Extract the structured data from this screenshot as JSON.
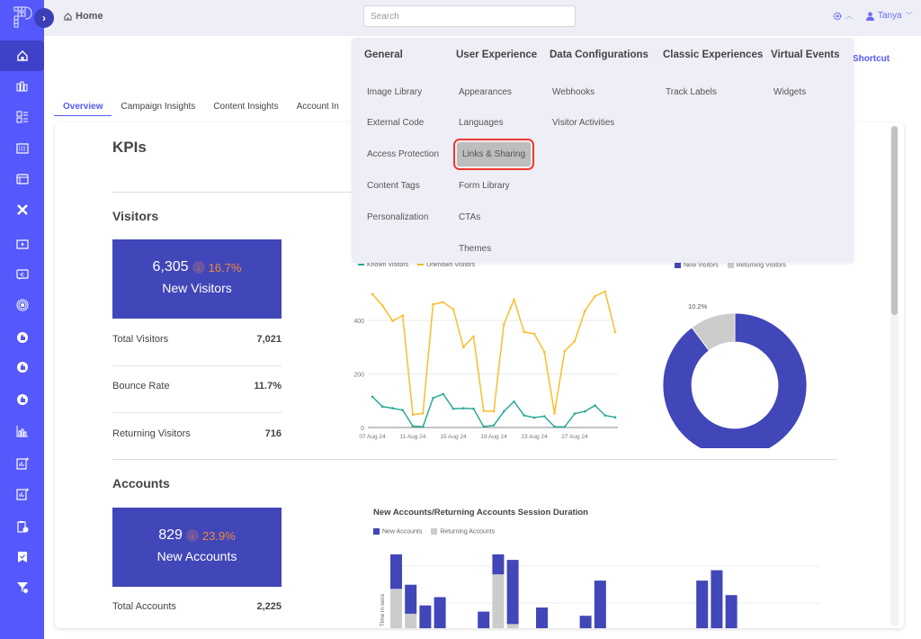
{
  "app": {
    "breadcrumb": "Home",
    "search_placeholder": "Search",
    "user_name": "Tanya",
    "colors": {
      "brand": "#5558fb",
      "stat_box": "#4146b8",
      "known": "#2aa997",
      "unknown": "#fbbd2c",
      "returning": "#cccccc",
      "down": "#f08a3c"
    }
  },
  "sidebar": {
    "items": [
      {
        "name": "home",
        "active": true
      },
      {
        "name": "analytics"
      },
      {
        "name": "content"
      },
      {
        "name": "layouts"
      },
      {
        "name": "pages"
      },
      {
        "name": "tools"
      },
      {
        "name": "videos"
      },
      {
        "name": "messages"
      },
      {
        "name": "targeting"
      },
      {
        "name": "engagement-1"
      },
      {
        "name": "engagement-2"
      },
      {
        "name": "engagement-3"
      },
      {
        "name": "reports"
      },
      {
        "name": "report-add-1"
      },
      {
        "name": "report-add-2"
      },
      {
        "name": "scheduled"
      },
      {
        "name": "bookmarks"
      },
      {
        "name": "filters"
      }
    ]
  },
  "main": {
    "shortcut_label": "Shortcut",
    "tabs": [
      {
        "label": "Overview",
        "active": true
      },
      {
        "label": "Campaign Insights"
      },
      {
        "label": "Content Insights"
      },
      {
        "label": "Account In"
      }
    ],
    "kpi_title": "KPIs",
    "visitors": {
      "title": "Visitors",
      "headline_value": "6,305",
      "headline_change": "16.7%",
      "headline_direction": "down",
      "headline_label": "New Visitors",
      "rows": [
        {
          "label": "Total Visitors",
          "value": "7,021"
        },
        {
          "label": "Bounce Rate",
          "value": "11.7%"
        },
        {
          "label": "Returning Visitors",
          "value": "716"
        }
      ]
    },
    "accounts": {
      "title": "Accounts",
      "headline_value": "829",
      "headline_change": "23.9%",
      "headline_direction": "down",
      "headline_label": "New Accounts",
      "rows": [
        {
          "label": "Total Accounts",
          "value": "2,225"
        }
      ]
    }
  },
  "megamenu": {
    "columns": [
      {
        "heading": "General",
        "items": [
          "Image Library",
          "External Code",
          "Access Protection",
          "Content Tags",
          "Personalization"
        ]
      },
      {
        "heading": "User Experience",
        "items": [
          "Appearances",
          "Languages",
          "Links & Sharing",
          "Form Library",
          "CTAs",
          "Themes"
        ],
        "selected": "Links & Sharing"
      },
      {
        "heading": "Data Configurations",
        "items": [
          "Webhooks",
          "Visitor Activities"
        ]
      },
      {
        "heading": "Classic Experiences",
        "items": [
          "Track Labels"
        ]
      },
      {
        "heading": "Virtual Events",
        "items": [
          "Widgets"
        ]
      }
    ]
  },
  "chart_data": [
    {
      "type": "line",
      "title": "",
      "legend": [
        "Known Visitors",
        "Unknown Visitors"
      ],
      "legend_position": "top-left",
      "x_tick_labels": [
        "07 Aug 24",
        "11 Aug 24",
        "15 Aug 24",
        "19 Aug 24",
        "23 Aug 24",
        "27 Aug 24"
      ],
      "y_tick_labels": [
        "0",
        "200",
        "400"
      ],
      "ylim": [
        0,
        520
      ],
      "grid": true,
      "x": [
        "07 Aug",
        "08 Aug",
        "09 Aug",
        "10 Aug",
        "11 Aug",
        "12 Aug",
        "13 Aug",
        "14 Aug",
        "15 Aug",
        "16 Aug",
        "17 Aug",
        "18 Aug",
        "19 Aug",
        "20 Aug",
        "21 Aug",
        "22 Aug",
        "23 Aug",
        "24 Aug",
        "25 Aug",
        "26 Aug",
        "27 Aug",
        "28 Aug",
        "29 Aug",
        "30 Aug",
        "31 Aug"
      ],
      "series": [
        {
          "name": "Known Visitors",
          "values": [
            115,
            78,
            72,
            65,
            5,
            3,
            110,
            125,
            70,
            72,
            70,
            3,
            8,
            60,
            97,
            45,
            37,
            42,
            3,
            2,
            52,
            60,
            82,
            45,
            38
          ]
        },
        {
          "name": "Unknown Visitors",
          "values": [
            498,
            455,
            398,
            418,
            48,
            53,
            460,
            468,
            442,
            300,
            340,
            62,
            60,
            385,
            478,
            357,
            350,
            282,
            53,
            285,
            323,
            435,
            490,
            508,
            357
          ]
        }
      ]
    },
    {
      "type": "pie",
      "legend": [
        "New Visitors",
        "Returning Visitors"
      ],
      "legend_position": "top",
      "slices": [
        {
          "label": "New Visitors",
          "value": 89.8,
          "display": "89.8%"
        },
        {
          "label": "Returning Visitors",
          "value": 10.2,
          "display": "10.2%"
        }
      ]
    },
    {
      "type": "bar",
      "stacked": true,
      "title": "New Accounts/Returning Accounts Session Duration",
      "ylabel": "Time in secs",
      "legend": [
        "New Accounts",
        "Returning Accounts"
      ],
      "legend_position": "top-left",
      "grid": true,
      "note": "Chart partially visible (clipped at bottom); values are relative heights from the visible baseline.",
      "series": [
        {
          "name": "New Accounts",
          "values": [
            17,
            14,
            11,
            15,
            0,
            0,
            8,
            38,
            31,
            0,
            10,
            0,
            0,
            6,
            23,
            0,
            0,
            0,
            0,
            0,
            0,
            23,
            28,
            16
          ]
        },
        {
          "name": "Returning Accounts",
          "values": [
            19,
            7,
            0,
            0,
            0,
            0,
            0,
            26,
            2,
            0,
            0,
            0,
            0,
            0,
            0,
            0,
            0,
            0,
            0,
            0,
            0,
            0,
            0,
            0
          ]
        }
      ]
    }
  ]
}
